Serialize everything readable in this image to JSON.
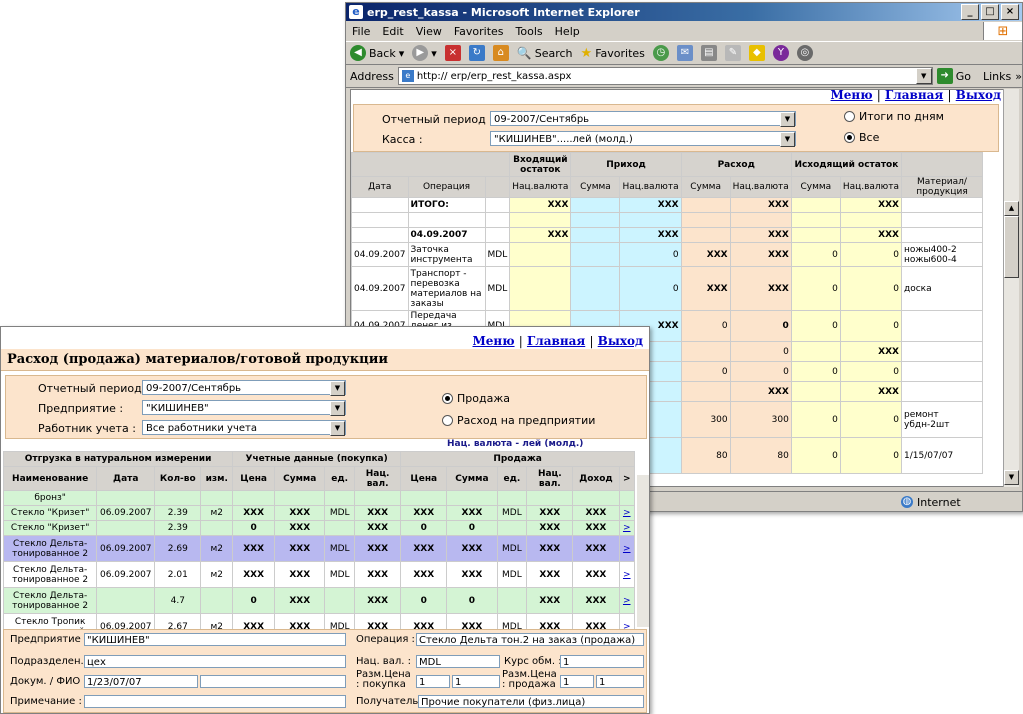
{
  "ie": {
    "title": "erp_rest_kassa - Microsoft Internet Explorer",
    "menu": [
      "File",
      "Edit",
      "View",
      "Favorites",
      "Tools",
      "Help"
    ],
    "toolbar": {
      "back": "Back",
      "search": "Search",
      "favorites": "Favorites"
    },
    "address_label": "Address",
    "address": "http:// erp/erp_rest_kassa.aspx",
    "go": "Go",
    "links": "Links",
    "status": "Internet"
  },
  "kassa": {
    "nav": {
      "menu": "Меню",
      "main": "Главная",
      "exit": "Выход",
      "sep": "|"
    },
    "period_label": "Отчетный период :",
    "period_value": "09-2007/Сентябрь",
    "kassa_label": "Касса :",
    "kassa_value": "\"КИШИНЕВ\".....лей (молд.)",
    "radio_days": "Итоги по дням",
    "radio_all": "Все",
    "headers": {
      "opening": "Входящий остаток",
      "income": "Приход",
      "expense": "Расход",
      "closing": "Исходящий остаток",
      "date": "Дата",
      "operation": "Операция",
      "nat": "Нац.валюта",
      "sum": "Сумма",
      "material": "Материал/ продукция"
    },
    "rows": [
      {
        "date": "",
        "op": "ИТОГО:",
        "cur": "",
        "in_nat": "XXX",
        "inc_sum": "",
        "inc_nat": "XXX",
        "exp_sum": "",
        "exp_nat": "XXX",
        "out_sum": "",
        "out_nat": "XXX",
        "mat": ""
      },
      {
        "date": "",
        "op": "",
        "cur": "",
        "in_nat": "",
        "inc_sum": "",
        "inc_nat": "",
        "exp_sum": "",
        "exp_nat": "",
        "out_sum": "",
        "out_nat": "",
        "mat": ""
      },
      {
        "date": "",
        "op": "04.09.2007",
        "cur": "",
        "in_nat": "XXX",
        "inc_sum": "",
        "inc_nat": "XXX",
        "exp_sum": "",
        "exp_nat": "XXX",
        "out_sum": "",
        "out_nat": "XXX",
        "mat": ""
      },
      {
        "date": "04.09.2007",
        "op": "Заточка инструмента",
        "cur": "MDL",
        "in_nat": "",
        "inc_sum": "",
        "inc_nat": "0",
        "exp_sum": "XXX",
        "exp_nat": "XXX",
        "out_sum": "0",
        "out_nat": "0",
        "mat": "ножы400-2 ножы600-4"
      },
      {
        "date": "04.09.2007",
        "op": "Транспорт - перевозка материалов на заказы",
        "cur": "MDL",
        "in_nat": "",
        "inc_sum": "",
        "inc_nat": "0",
        "exp_sum": "XXX",
        "exp_nat": "XXX",
        "out_sum": "0",
        "out_nat": "0",
        "mat": "доска"
      },
      {
        "date": "04.09.2007",
        "op": "Передача денег из кассы в кассу",
        "cur": "MDL",
        "in_nat": "",
        "inc_sum": "",
        "inc_nat": "XXX",
        "exp_sum": "0",
        "exp_nat": "0",
        "out_sum": "0",
        "out_nat": "0",
        "mat": ""
      }
    ],
    "peek": [
      {
        "a": "",
        "b": "0",
        "c": "",
        "d": "XXX",
        "mat": ""
      },
      {
        "a": "0",
        "b": "0",
        "c": "0",
        "d": "0",
        "mat": ""
      },
      {
        "a": "",
        "b": "XXX",
        "c": "",
        "d": "XXX",
        "mat": ""
      },
      {
        "a": "300",
        "b": "300",
        "c": "0",
        "d": "0",
        "mat": "ремонт убдн-2шт"
      },
      {
        "a": "80",
        "b": "80",
        "c": "0",
        "d": "0",
        "mat": "1/15/07/07"
      }
    ]
  },
  "sales": {
    "nav": {
      "menu": "Меню",
      "main": "Главная",
      "exit": "Выход",
      "sep": "|"
    },
    "title": "Расход (продажа) материалов/готовой продукции",
    "period_label": "Отчетный период :",
    "period_value": "09-2007/Сентябрь",
    "enterprise_label": "Предприятие :",
    "enterprise_value": "\"КИШИНЕВ\"",
    "worker_label": "Работник учета :",
    "worker_value": "Все работники учета",
    "radio_sale": "Продажа",
    "radio_consumption": "Расход на предприятии",
    "currency_note": "Нац. валюта - лей (молд.)",
    "group_headers": {
      "natural": "Отгрузка в натуральном измерении",
      "account": "Учетные данные (покупка)",
      "sale": "Продажа"
    },
    "columns": [
      "Наименование",
      "Дата",
      "Кол-во",
      "изм.",
      "Цена",
      "Сумма",
      "ед.",
      "Нац. вал.",
      "Цена",
      "Сумма",
      "ед.",
      "Нац. вал.",
      "Доход",
      ">"
    ],
    "first_partial": "бронз\"",
    "rows": [
      {
        "name": "Стекло \"Кризет\"",
        "date": "06.09.2007",
        "qty": "2.39",
        "unit": "м2",
        "p1": "XXX",
        "s1": "XXX",
        "c1": "MDL",
        "n1": "XXX",
        "p2": "XXX",
        "s2": "XXX",
        "c2": "MDL",
        "n2": "XXX",
        "inc": "XXX",
        "cls": "g"
      },
      {
        "name": "Стекло \"Кризет\"",
        "date": "",
        "qty": "2.39",
        "unit": "",
        "p1": "0",
        "s1": "XXX",
        "c1": "",
        "n1": "XXX",
        "p2": "0",
        "s2": "0",
        "c2": "",
        "n2": "XXX",
        "inc": "XXX",
        "cls": "g"
      },
      {
        "name": "Стекло Дельта-тонированное 2",
        "date": "06.09.2007",
        "qty": "2.69",
        "unit": "м2",
        "p1": "XXX",
        "s1": "XXX",
        "c1": "MDL",
        "n1": "XXX",
        "p2": "XXX",
        "s2": "XXX",
        "c2": "MDL",
        "n2": "XXX",
        "inc": "XXX",
        "cls": "sel"
      },
      {
        "name": "Стекло Дельта-тонированное 2",
        "date": "06.09.2007",
        "qty": "2.01",
        "unit": "м2",
        "p1": "XXX",
        "s1": "XXX",
        "c1": "MDL",
        "n1": "XXX",
        "p2": "XXX",
        "s2": "XXX",
        "c2": "MDL",
        "n2": "XXX",
        "inc": "XXX",
        "cls": "w"
      },
      {
        "name": "Стекло Дельта-тонированное 2",
        "date": "",
        "qty": "4.7",
        "unit": "",
        "p1": "0",
        "s1": "XXX",
        "c1": "",
        "n1": "XXX",
        "p2": "0",
        "s2": "0",
        "c2": "",
        "n2": "XXX",
        "inc": "XXX",
        "cls": "g"
      },
      {
        "name": "Стекло Тропик тонированный",
        "date": "06.09.2007",
        "qty": "2.67",
        "unit": "м2",
        "p1": "XXX",
        "s1": "XXX",
        "c1": "MDL",
        "n1": "XXX",
        "p2": "XXX",
        "s2": "XXX",
        "c2": "MDL",
        "n2": "XXX",
        "inc": "XXX",
        "cls": "w"
      }
    ],
    "detail": {
      "enterprise_label": "Предприятие :",
      "enterprise_value": "\"КИШИНЕВ\"",
      "dept_label": "Подразделен. :",
      "dept_value": "цех",
      "doc_label": "Докум. / ФИО :",
      "doc_value": "1/23/07/07",
      "note_label": "Примечание :",
      "operation_label": "Операция :",
      "operation_value": "Стекло Дельта тон.2 на заказ (продажа)",
      "currency_label": "Нац. вал. :",
      "currency_value": "MDL",
      "rate_label": "Курс обм. :",
      "rate_value": "1",
      "dim_buy_label": "Разм.Цена : покупка",
      "dim_buy_1": "1",
      "dim_buy_2": "1",
      "dim_sell_label": "Разм.Цена : продажа",
      "dim_sell_1": "1",
      "dim_sell_2": "1",
      "receiver_label": "Получатель :",
      "receiver_value": "Прочие покупатели (физ.лица)"
    }
  }
}
